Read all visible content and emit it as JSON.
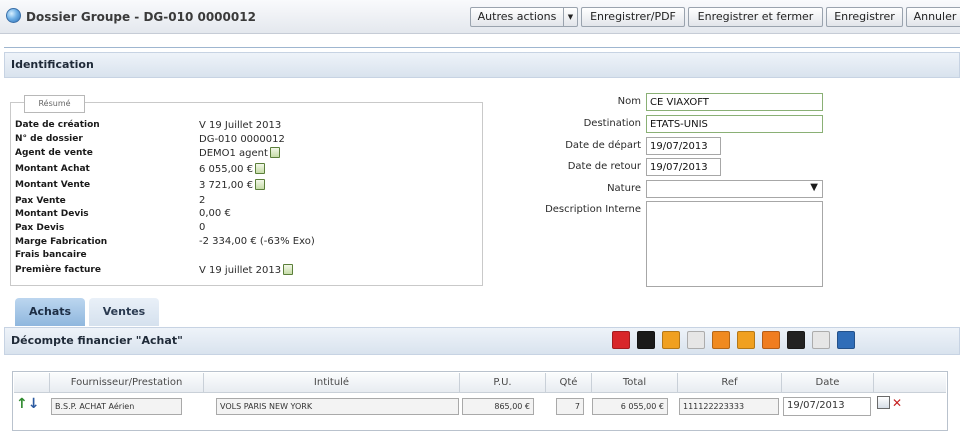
{
  "window": {
    "title": "Dossier Groupe - DG-010 0000012"
  },
  "toolbar": {
    "other_actions": "Autres actions",
    "save_pdf": "Enregistrer/PDF",
    "save_close": "Enregistrer et fermer",
    "save": "Enregistrer",
    "cancel": "Annuler"
  },
  "identification": {
    "section_title": "Identification",
    "summary_legend": "Résumé",
    "summary": [
      {
        "label": "Date de création",
        "value": "V 19 Juillet 2013"
      },
      {
        "label": "N° de dossier",
        "value": "DG-010 0000012"
      },
      {
        "label": "Agent de vente",
        "value": "DEMO1 agent"
      },
      {
        "label": "Montant Achat",
        "value": "6 055,00 €"
      },
      {
        "label": "Montant Vente",
        "value": "3 721,00 €"
      },
      {
        "label": "Pax Vente",
        "value": "2"
      },
      {
        "label": "Montant Devis",
        "value": "0,00 €"
      },
      {
        "label": "Pax Devis",
        "value": "0"
      },
      {
        "label": "Marge Fabrication",
        "value": "-2 334,00 € (-63% Exo)"
      },
      {
        "label": "Frais bancaire",
        "value": ""
      },
      {
        "label": "Première facture",
        "value": "V 19 juillet 2013"
      }
    ],
    "form": {
      "nom_label": "Nom",
      "nom_value": "CE VIAXOFT",
      "destination_label": "Destination",
      "destination_value": "ETATS-UNIS",
      "depart_label": "Date de départ",
      "depart_value": "19/07/2013",
      "retour_label": "Date de retour",
      "retour_value": "19/07/2013",
      "nature_label": "Nature",
      "nature_value": "",
      "description_label": "Description Interne",
      "description_value": ""
    }
  },
  "tabs": {
    "achats": "Achats",
    "ventes": "Ventes"
  },
  "decompte": {
    "title": "Décompte financier \"Achat\"",
    "icons": [
      "pdf-icon",
      "acrobat-icon",
      "orange-tag-icon",
      "document-icon",
      "pen-icon",
      "orange-doc-icon",
      "orange-note-icon",
      "car-icon",
      "gray-note-icon",
      "blue-doc-icon"
    ],
    "icon_colors": [
      "#d8262a",
      "#1a1a1a",
      "#f0a020",
      "#e6e6e6",
      "#f08a20",
      "#f0a020",
      "#f07d20",
      "#222222",
      "#e6e6e6",
      "#2f6db8"
    ],
    "columns": [
      "Fournisseur/Prestation",
      "Intitulé",
      "P.U.",
      "Qté",
      "Total",
      "Ref",
      "Date"
    ],
    "rows": [
      {
        "fournisseur": "B.S.P. ACHAT Aérien",
        "intitule": "VOLS PARIS NEW YORK",
        "pu": "865,00 €",
        "qte": "7",
        "total": "6 055,00 €",
        "ref": "111122223333",
        "date": "19/07/2013"
      }
    ]
  }
}
